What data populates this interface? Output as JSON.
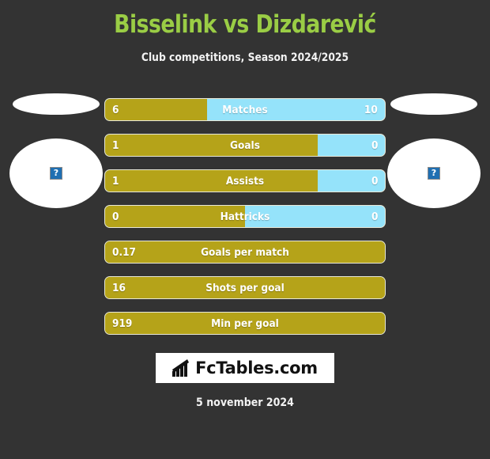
{
  "header": {
    "title": "Bisselink vs Dizdarević",
    "subtitle": "Club competitions, Season 2024/2025",
    "title_color": "#9ACD45"
  },
  "theme": {
    "background": "#333333",
    "home_bar_color": "#B5A319",
    "away_bar_color": "#95E3FA",
    "text_color": "#FFFFFF"
  },
  "players": {
    "home": {
      "flag_icon": "flag-placeholder",
      "photo_icon": "broken-image-icon",
      "broken_glyph": "?"
    },
    "away": {
      "flag_icon": "flag-placeholder",
      "photo_icon": "broken-image-icon",
      "broken_glyph": "?"
    }
  },
  "stats": [
    {
      "label": "Matches",
      "home": "6",
      "away": "10",
      "home_pct": 36.5,
      "has_away": true
    },
    {
      "label": "Goals",
      "home": "1",
      "away": "0",
      "home_pct": 76.0,
      "has_away": true
    },
    {
      "label": "Assists",
      "home": "1",
      "away": "0",
      "home_pct": 76.0,
      "has_away": true
    },
    {
      "label": "Hattricks",
      "home": "0",
      "away": "0",
      "home_pct": 50.0,
      "has_away": true
    },
    {
      "label": "Goals per match",
      "home": "0.17",
      "away": "",
      "home_pct": 100,
      "has_away": false
    },
    {
      "label": "Shots per goal",
      "home": "16",
      "away": "",
      "home_pct": 100,
      "has_away": false
    },
    {
      "label": "Min per goal",
      "home": "919",
      "away": "",
      "home_pct": 100,
      "has_away": false
    }
  ],
  "footer": {
    "logo_text": "FcTables.com",
    "logo_icon": "bar-chart-icon",
    "date": "5 november 2024"
  }
}
